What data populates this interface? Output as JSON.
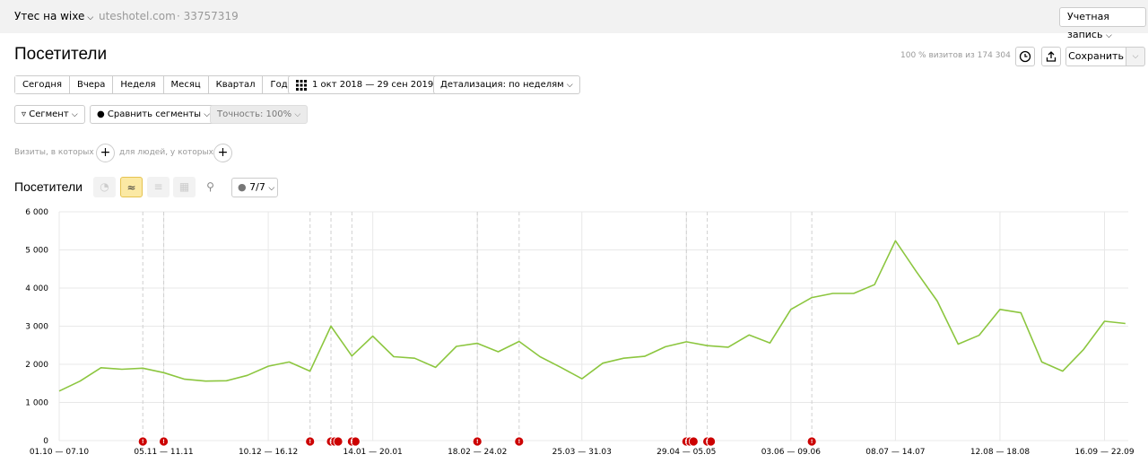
{
  "header": {
    "site_name": "Утес на wixe",
    "site_domain": "uteshotel.com",
    "site_id": "· 33757319",
    "account_button": "Учетная запись"
  },
  "page": {
    "title": "Посетители",
    "visits_info": "100 % визитов из 174 304",
    "save_label": "Сохранить"
  },
  "periods": [
    "Сегодня",
    "Вчера",
    "Неделя",
    "Месяц",
    "Квартал",
    "Год"
  ],
  "date_range": "1 окт 2018 — 29 сен 2019",
  "detail": "Детализация: по неделям",
  "segment_label": "Сегмент",
  "compare_label": "Сравнить сегменты",
  "accuracy_label": "Точность: 100%",
  "filter": {
    "visits_label": "Визиты, в которых",
    "people_label": "для людей, у которых"
  },
  "chart_section": {
    "title": "Посетители",
    "series_count": "7/7"
  },
  "colors": {
    "line": "#8cc63f",
    "note": "#cc0000",
    "grid": "#e8e8e8"
  },
  "chart_data": {
    "type": "line",
    "title": "",
    "ylim": [
      0,
      6000
    ],
    "yticks": [
      "0",
      "1 000",
      "2 000",
      "3 000",
      "4 000",
      "5 000",
      "6 000"
    ],
    "xtick_labels": [
      "01.10 — 07.10",
      "05.11 — 11.11",
      "10.12 — 16.12",
      "14.01 — 20.01",
      "18.02 — 24.02",
      "25.03 — 31.03",
      "29.04 — 05.05",
      "03.06 — 09.06",
      "08.07 — 14.07",
      "12.08 — 18.08",
      "16.09 — 22.09"
    ],
    "xtick_index": [
      0,
      5,
      10,
      15,
      20,
      25,
      30,
      35,
      40,
      45,
      50
    ],
    "series": [
      {
        "values": [
          1300,
          1560,
          1910,
          1870,
          1900,
          1780,
          1610,
          1560,
          1570,
          1710,
          1950,
          2060,
          1820,
          3000,
          2220,
          2740,
          2200,
          2160,
          1920,
          2470,
          2550,
          2330,
          2600,
          2200,
          1920,
          1620,
          2030,
          2160,
          2210,
          2460,
          2590,
          2490,
          2450,
          2770,
          2560,
          3440,
          3750,
          3860,
          3860,
          4090,
          5240,
          4430,
          3660,
          2530,
          2760,
          3440,
          3350,
          2060,
          1820,
          2390,
          3130,
          3070
        ]
      }
    ],
    "annotations": [
      {
        "index": 4,
        "count": 1,
        "glyph": "!"
      },
      {
        "index": 5,
        "count": 1,
        "glyph": "!"
      },
      {
        "index": 12,
        "count": 1,
        "glyph": "!"
      },
      {
        "index": 13,
        "count": 3,
        "glyph": "!"
      },
      {
        "index": 14,
        "count": 2,
        "glyph": "!"
      },
      {
        "index": 20,
        "count": 1,
        "glyph": "!"
      },
      {
        "index": 22,
        "count": 1,
        "glyph": "!"
      },
      {
        "index": 30,
        "count": 3,
        "glyph": "!"
      },
      {
        "index": 31,
        "count": 2,
        "glyph": "!"
      },
      {
        "index": 36,
        "count": 1,
        "glyph": "!"
      }
    ]
  }
}
